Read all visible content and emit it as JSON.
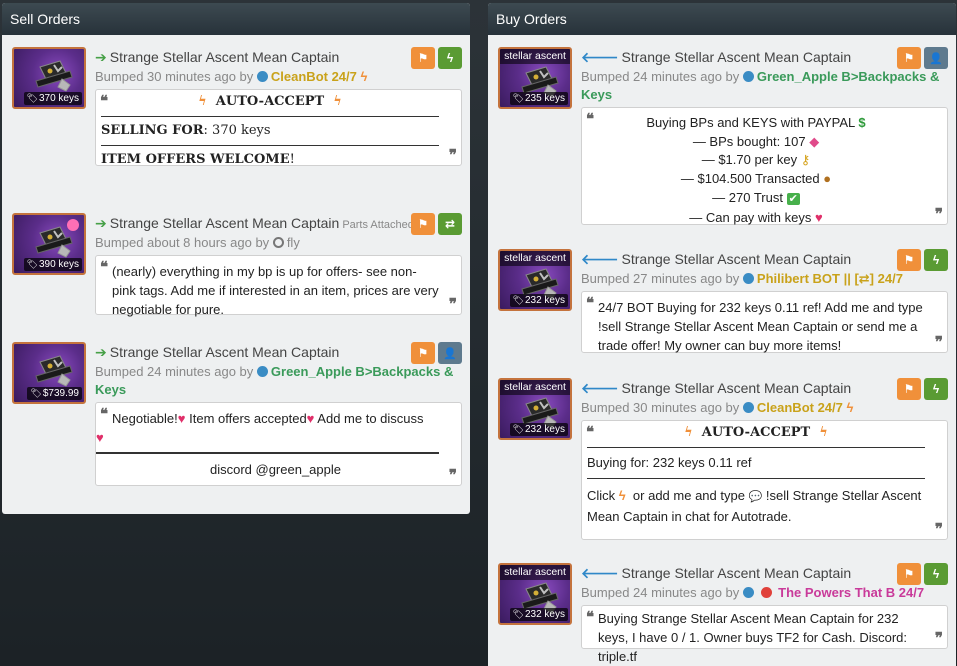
{
  "sell": {
    "header": "Sell Orders",
    "listings": [
      {
        "title": "Strange Stellar Ascent Mean Captain",
        "price": "370 keys",
        "bumped": "Bumped 30 minutes ago by",
        "user": "CleanBot 24/7",
        "user_color": "#c9a21a",
        "comment": {
          "heading": "AUTO-ACCEPT",
          "sell_label": "SELLING FOR",
          "sell_value": ": 370 keys",
          "offers_label": "ITEM OFFERS WELCOME",
          "offers_tail": "!"
        }
      },
      {
        "title": "Strange Stellar Ascent Mean Captain",
        "parts": "Parts Attached",
        "price": "390 keys",
        "bumped": "Bumped about 8 hours ago by",
        "user": "fly",
        "comment": "(nearly) everything in my bp is up for offers- see non-pink tags. Add me if interested in an item, prices are very negotiable for pure."
      },
      {
        "title": "Strange Stellar Ascent Mean Captain",
        "price": "$739.99",
        "bumped": "Bumped 24 minutes ago by",
        "user": "Green_Apple B>Backpacks & Keys",
        "user_color": "#3a9a5a",
        "comment": {
          "a": "Negotiable!",
          "b": "Item offers accepted",
          "c": "Add me to discuss",
          "footer": "discord @green_apple"
        }
      }
    ]
  },
  "buy": {
    "header": "Buy Orders",
    "image_label": "stellar ascent",
    "listings": [
      {
        "title": "Strange Stellar Ascent Mean Captain",
        "price": "235 keys",
        "bumped": "Bumped 24 minutes ago by",
        "user": "Green_Apple B>Backpacks & Keys",
        "user_color": "#3a9a5a",
        "comment": {
          "l1": "Buying BPs and KEYS with PAYPAL",
          "l2": "— BPs bought: 107",
          "l3": "— $1.70 per key",
          "l4": "— $104.500 Transacted",
          "l5": "— 270 Trust",
          "l6": "— Can pay with keys"
        }
      },
      {
        "title": "Strange Stellar Ascent Mean Captain",
        "price": "232 keys",
        "bumped": "Bumped 27 minutes ago by",
        "user": "Philibert BOT || [⇄] 24/7",
        "user_color": "#c9a21a",
        "comment": "24/7 BOT Buying for 232 keys 0.11 ref! Add me and type !sell Strange Stellar Ascent Mean Captain or send me a trade offer! My owner can buy more items!"
      },
      {
        "title": "Strange Stellar Ascent Mean Captain",
        "price": "232 keys",
        "bumped": "Bumped 30 minutes ago by",
        "user": "CleanBot 24/7",
        "user_color": "#c9a21a",
        "comment": {
          "heading": "AUTO-ACCEPT",
          "buying": "Buying for: 232 keys 0.11 ref",
          "click": "Click",
          "mid": "or add me and type",
          "tail": "!sell Strange Stellar Ascent Mean Captain in chat for Autotrade."
        }
      },
      {
        "title": "Strange Stellar Ascent Mean Captain",
        "price": "232 keys",
        "bumped": "Bumped 24 minutes ago by",
        "user": "The Powers That B 24/7",
        "user_color": "#c93a9a",
        "comment": "Buying Strange Stellar Ascent Mean Captain for 232 keys, I have 0 / 1. Owner buys TF2 for Cash. Discord: triple.tf"
      }
    ]
  },
  "glyphs": {
    "flag": "⚑",
    "bolt": "ϟ",
    "swap": "⇄",
    "add_user": "👤",
    "arrow_right": "➔",
    "arrow_left": "🡐",
    "tag": "🏷",
    "quote_open": "❝",
    "quote_close": "❞",
    "heart": "♥",
    "dollar": "$",
    "pink_tag": "◆",
    "key": "⚷",
    "money_bag": "●",
    "check": "✔",
    "bubble": "💬"
  },
  "colors": {
    "orange_button": "#f0903a",
    "green_button": "#5a9b33",
    "slate_button": "#5e7a8e",
    "item_border": "#c4733d"
  }
}
